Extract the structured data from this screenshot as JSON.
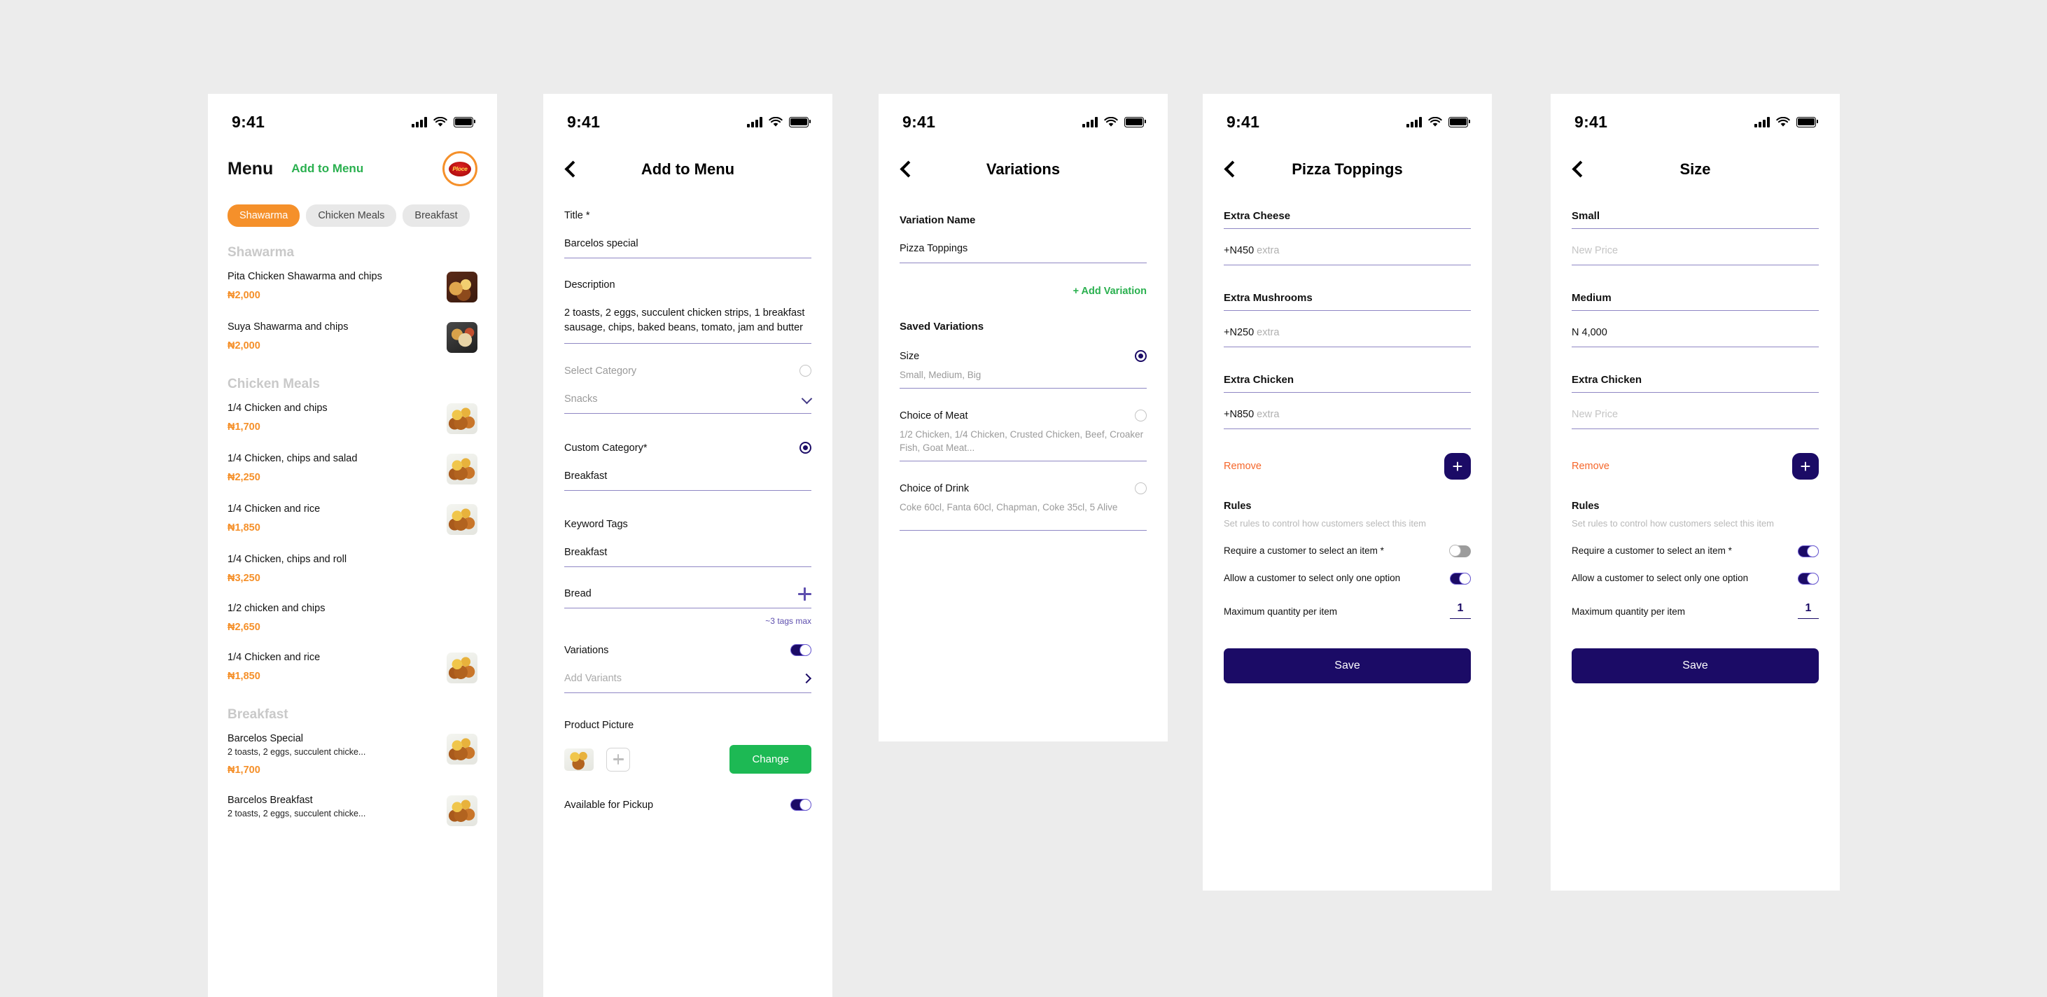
{
  "statusbar": {
    "time": "9:41"
  },
  "screens": {
    "menu": {
      "title": "Menu",
      "add_to_menu": "Add to Menu",
      "brand_logo": "Ploce",
      "tabs": [
        {
          "label": "Shawarma",
          "active": true
        },
        {
          "label": "Chicken Meals",
          "active": false
        },
        {
          "label": "Breakfast",
          "active": false
        }
      ],
      "groups": [
        {
          "heading": "Shawarma",
          "items": [
            {
              "name": "Pita Chicken Shawarma and chips",
              "desc": "",
              "price": "₦2,000",
              "thumb": "shawarma1"
            },
            {
              "name": "Suya Shawarma and chips",
              "desc": "",
              "price": "₦2,000",
              "thumb": "shawarma2"
            }
          ]
        },
        {
          "heading": "Chicken Meals",
          "items": [
            {
              "name": "1/4 Chicken and chips",
              "desc": "",
              "price": "₦1,700",
              "thumb": "chicken"
            },
            {
              "name": "1/4 Chicken, chips and salad",
              "desc": "",
              "price": "₦2,250",
              "thumb": "chicken"
            },
            {
              "name": "1/4 Chicken and rice",
              "desc": "",
              "price": "₦1,850",
              "thumb": "chicken"
            },
            {
              "name": "1/4 Chicken, chips and roll",
              "desc": "",
              "price": "₦3,250",
              "thumb": "none"
            },
            {
              "name": "1/2 chicken and chips",
              "desc": "",
              "price": "₦2,650",
              "thumb": "none"
            },
            {
              "name": "1/4 Chicken and rice",
              "desc": "",
              "price": "₦1,850",
              "thumb": "chicken"
            }
          ]
        },
        {
          "heading": "Breakfast",
          "items": [
            {
              "name": "Barcelos Special",
              "desc": "2 toasts, 2 eggs, succulent chicke...",
              "price": "₦1,700",
              "thumb": "chicken"
            },
            {
              "name": "Barcelos Breakfast",
              "desc": "2 toasts, 2 eggs, succulent chicke...",
              "price": "",
              "thumb": "chicken"
            }
          ]
        }
      ]
    },
    "add_to_menu": {
      "title": "Add to Menu",
      "title_label": "Title *",
      "title_value": "Barcelos special",
      "description_label": "Description",
      "description_value": "2 toasts, 2 eggs, succulent chicken strips, 1 breakfast sausage, chips, baked beans, tomato, jam and butter",
      "select_category_label": "Select Category",
      "select_category_value": "Snacks",
      "custom_category_label": "Custom Category*",
      "custom_category_value": "Breakfast",
      "keyword_tags_label": "Keyword Tags",
      "keyword_tag_1": "Breakfast",
      "keyword_tag_2": "Bread",
      "tags_hint": "~3 tags max",
      "variations_label": "Variations",
      "add_variants_placeholder": "Add Variants",
      "product_picture_label": "Product Picture",
      "change_button": "Change",
      "available_for_pickup_label": "Available for Pickup"
    },
    "variations": {
      "title": "Variations",
      "variation_name_label": "Variation Name",
      "variation_name_value": "Pizza Toppings",
      "add_variation": "+ Add Variation",
      "saved_variations_label": "Saved Variations",
      "saved": [
        {
          "name": "Size",
          "options": "Small, Medium, Big",
          "selected": true
        },
        {
          "name": "Choice of Meat",
          "options": "1/2 Chicken, 1/4 Chicken, Crusted Chicken, Beef, Croaker Fish, Goat Meat...",
          "selected": false
        },
        {
          "name": "Choice of Drink",
          "options": "Coke 60cl, Fanta 60cl, Chapman, Coke 35cl, 5 Alive",
          "selected": false
        }
      ]
    },
    "pizza_toppings": {
      "title": "Pizza Toppings",
      "options": [
        {
          "name": "Extra Cheese",
          "price": "+N450",
          "suffix": "extra",
          "placeholder": false
        },
        {
          "name": "Extra Mushrooms",
          "price": "+N250",
          "suffix": "extra",
          "placeholder": false
        },
        {
          "name": "Extra Chicken",
          "price": "+N850",
          "suffix": "extra",
          "placeholder": false
        }
      ],
      "remove": "Remove",
      "add_icon": "plus-icon",
      "rules_title": "Rules",
      "rules_subtitle": "Set rules to control how customers select this item",
      "rule_require_label": "Require a customer to select an item *",
      "rule_require_on": false,
      "rule_single_label": "Allow a customer to select only one option",
      "rule_single_on": true,
      "max_qty_label": "Maximum quantity per item",
      "max_qty_value": "1",
      "save": "Save"
    },
    "size": {
      "title": "Size",
      "options": [
        {
          "name": "Small",
          "price": "New Price",
          "suffix": "",
          "placeholder": true
        },
        {
          "name": "Medium",
          "price": "N 4,000",
          "suffix": "",
          "placeholder": false
        },
        {
          "name": "Extra Chicken",
          "price": "New Price",
          "suffix": "",
          "placeholder": true
        }
      ],
      "remove": "Remove",
      "add_icon": "plus-icon",
      "rules_title": "Rules",
      "rules_subtitle": "Set rules to control how customers select this item",
      "rule_require_label": "Require a customer to select an item *",
      "rule_require_on": true,
      "rule_single_label": "Allow a customer to select only one option",
      "rule_single_on": true,
      "max_qty_label": "Maximum quantity per item",
      "max_qty_value": "1",
      "save": "Save"
    }
  },
  "colors": {
    "accent_orange": "#f5902a",
    "accent_green": "#2ab04f",
    "accent_navy": "#1b0b66",
    "remove_red": "#f5662a"
  }
}
